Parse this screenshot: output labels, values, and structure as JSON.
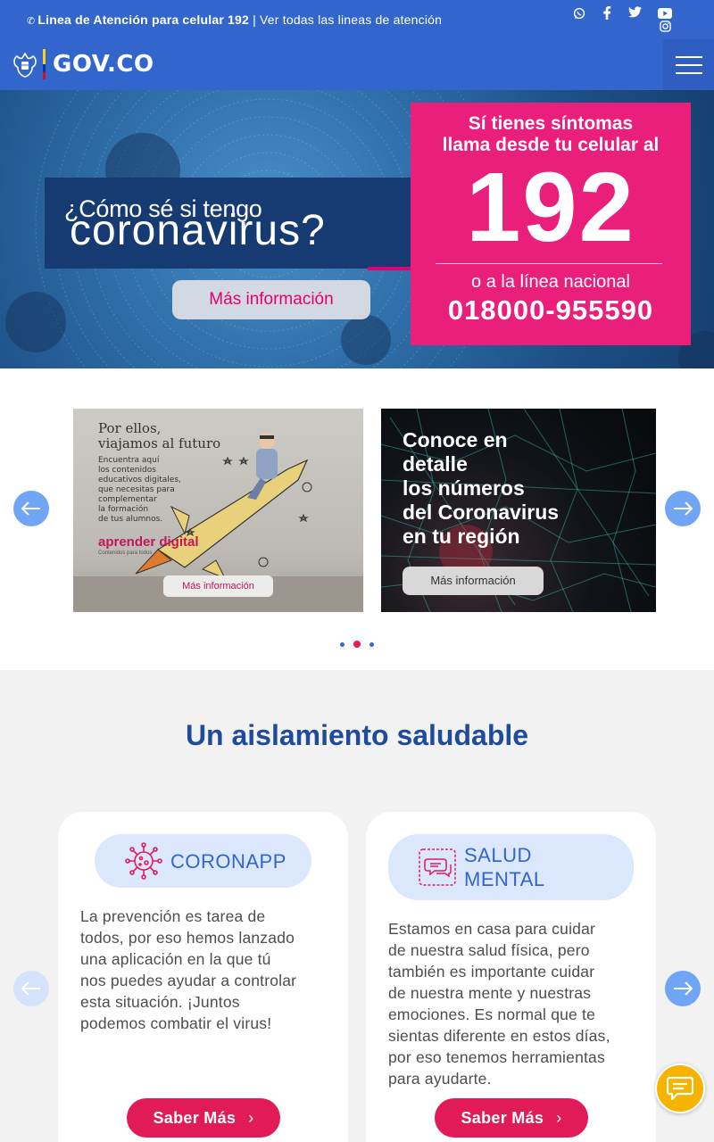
{
  "topbar": {
    "hotline_bold": "Linea de Atención para celular 192",
    "separator": "|",
    "all_lines": "Ver todas las lineas de atención",
    "social_icons": [
      "whatsapp-icon",
      "facebook-icon",
      "twitter-icon",
      "youtube-icon",
      "instagram-icon"
    ]
  },
  "header": {
    "logo_text": "GOV.CO",
    "menu_icon": "hamburger-menu-icon"
  },
  "hero": {
    "question_line1": "¿Cómo sé si tengo",
    "question_line2": "coronavirus?",
    "more_button": "Más información",
    "symptoms_line1": "Sí tienes síntomas",
    "symptoms_line2": "llama desde tu celular al",
    "number": "192",
    "national_line": "o a la línea nacional",
    "national_number": "018000-955590"
  },
  "carousel": {
    "slides": [
      {
        "title_line1": "Por ellos,",
        "title_line2": "viajamos al futuro",
        "body": [
          "Encuentra aquí",
          "los contenidos",
          "educativos digitales,",
          "que necesitas para",
          "complementar",
          "la formación",
          "de tus alumnos."
        ],
        "brand": "aprender digital",
        "brand_tagline": "Contenidos para todos",
        "button": "Más información"
      },
      {
        "title": [
          "Conoce en",
          "detalle",
          "los números",
          "del Coronavirus",
          "en tu región"
        ],
        "button": "Más información"
      }
    ],
    "dots": 3,
    "active_dot": 2
  },
  "section": {
    "title": "Un aislamiento saludable",
    "cards": [
      {
        "label": "CORONAPP",
        "icon": "virus-icon",
        "text": [
          "La prevención es tarea de",
          "todos, por eso hemos lanzado",
          "una aplicación en la que tú",
          "nos puedes ayudar a controlar",
          "esta situación. ¡Juntos",
          "podemos combatir el virus!"
        ],
        "button": "Saber Más"
      },
      {
        "label_line1": "SALUD",
        "label_line2": "MENTAL",
        "icon": "chat-bubbles-icon",
        "text": [
          "Estamos en casa para cuidar",
          "de nuestra salud física, pero",
          "también es importante cuidar",
          "de nuestra mente y nuestras",
          "emociones. Es normal que te",
          "sientas diferente en estos días,",
          "por eso tenemos herramientas",
          "para ayudarte."
        ],
        "button": "Saber Más"
      }
    ]
  },
  "colors": {
    "gov_blue": "#3366cc",
    "pink": "#ea1f7b",
    "button_red": "#e01b56",
    "title_blue": "#1f4b9b",
    "chat_yellow": "#f6b300"
  }
}
